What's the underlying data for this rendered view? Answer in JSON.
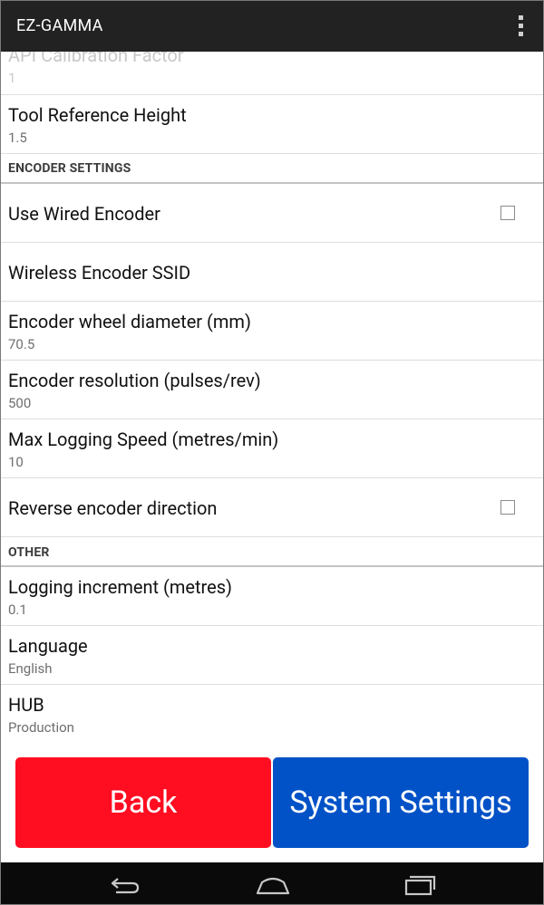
{
  "app": {
    "title": "EZ-GAMMA"
  },
  "icons": {
    "overflow": "overflow-menu-icon",
    "back": "nav-back-icon",
    "home": "nav-home-icon",
    "recents": "nav-recents-icon"
  },
  "prefs": {
    "api_calibration": {
      "title": "API Calibration Factor",
      "summary": "1"
    },
    "tool_reference_height": {
      "title": "Tool Reference Height",
      "summary": "1.5"
    },
    "encoder_header": "ENCODER SETTINGS",
    "use_wired_encoder": {
      "title": "Use Wired Encoder",
      "checked": false
    },
    "wireless_ssid": {
      "title": "Wireless Encoder SSID"
    },
    "wheel_diameter": {
      "title": "Encoder wheel diameter (mm)",
      "summary": "70.5"
    },
    "resolution": {
      "title": "Encoder resolution (pulses/rev)",
      "summary": "500"
    },
    "max_speed": {
      "title": "Max Logging Speed (metres/min)",
      "summary": "10"
    },
    "reverse_direction": {
      "title": "Reverse encoder direction",
      "checked": false
    },
    "other_header": "OTHER",
    "logging_increment": {
      "title": "Logging increment (metres)",
      "summary": "0.1"
    },
    "language": {
      "title": "Language",
      "summary": "English"
    },
    "hub": {
      "title": "HUB",
      "summary": "Production"
    }
  },
  "buttons": {
    "back": "Back",
    "system_settings": "System Settings"
  },
  "colors": {
    "action_bar": "#222222",
    "back_button": "#ff0d21",
    "system_button": "#0152c7",
    "nav_bar": "#0a0a0a"
  }
}
